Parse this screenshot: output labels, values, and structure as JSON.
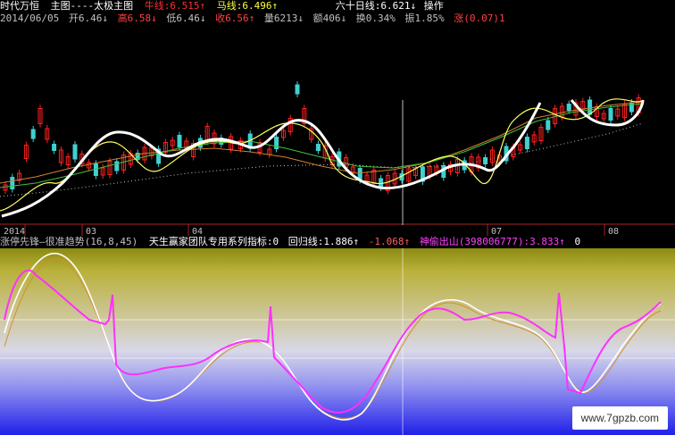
{
  "header": {
    "stock_name": "时代万恒",
    "chart_title": "主图----太极主图",
    "avg_labels": [
      {
        "text": "牛线:6.515↑",
        "color": "#ff3030"
      },
      {
        "text": "马线:6.496↑",
        "color": "#ffff40"
      }
    ],
    "sixty_line": "六十日线:6.621↓",
    "operation": "操作",
    "row2": [
      {
        "text": "2014/06/05",
        "color": "#c0c0c0"
      },
      {
        "text": "开6.46↓",
        "color": "#c0c0c0"
      },
      {
        "text": "高6.58↓",
        "color": "#ff4040"
      },
      {
        "text": "低6.46↓",
        "color": "#c0c0c0"
      },
      {
        "text": "收6.56↑",
        "color": "#ff4040"
      },
      {
        "text": "量6213↓",
        "color": "#c0c0c0"
      },
      {
        "text": "额406↓",
        "color": "#c0c0c0"
      },
      {
        "text": "换0.34%",
        "color": "#c0c0c0"
      },
      {
        "text": "振1.85%",
        "color": "#c0c0c0"
      },
      {
        "text": "涨(0.07)1",
        "color": "#ff4040"
      }
    ]
  },
  "x_axis": {
    "year_label": "2014",
    "months": [
      "03",
      "04",
      "07",
      "08"
    ]
  },
  "indicator_header": [
    {
      "text": "涨停先锋—很准趋势(16,8,45)",
      "color": "#c0c0c0"
    },
    {
      "text": "天生赢家团队专用系列指标:0",
      "color": "#ffffff"
    },
    {
      "text": "回归线:1.886↑",
      "color": "#ffffff"
    },
    {
      "text": "-1.068↑",
      "color": "#ff6060"
    },
    {
      "text": "神偷出山(398006777):3.833↑",
      "color": "#ff40ff"
    },
    {
      "text": "0",
      "color": "#ffffff"
    }
  ],
  "watermark": "www.7gpzb.com",
  "colors": {
    "up": "#ff2020",
    "down": "#40d0d0",
    "white_line": "#ffffff",
    "yellow_line": "#ffff60",
    "magenta": "#ff30ff",
    "orange": "#d08030",
    "green": "#40c040"
  }
}
